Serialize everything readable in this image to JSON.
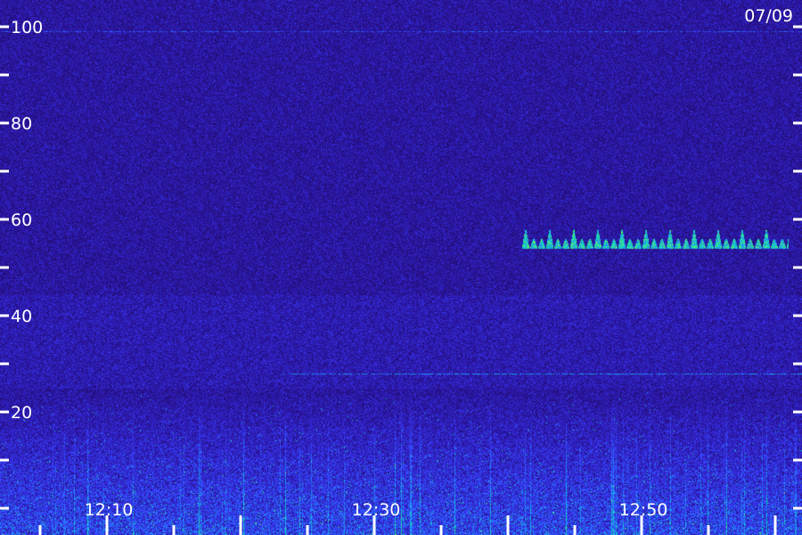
{
  "chart_data": {
    "type": "heatmap",
    "title": "",
    "date_label": "07/09",
    "xlabel": "",
    "ylabel": "",
    "y_axis": {
      "range": [
        0,
        100
      ],
      "labeled_ticks": [
        "20",
        "40",
        "60",
        "80",
        "100"
      ],
      "tick_values": [
        0,
        10,
        20,
        30,
        40,
        50,
        60,
        70,
        80,
        90,
        100
      ],
      "ticks_on_both_sides": true
    },
    "x_axis": {
      "labeled_ticks": [
        "12:10",
        "12:30",
        "12:50"
      ],
      "label_minutes": [
        10,
        30,
        50
      ],
      "major_tick_minutes": [
        0,
        10,
        20,
        30,
        40,
        50,
        60
      ],
      "minor_tick_minutes": [
        5,
        15,
        25,
        35,
        45,
        55
      ],
      "range_minutes": [
        2,
        62
      ]
    },
    "colormap": [
      "#1e0a52",
      "#2a14a0",
      "#3a3cff",
      "#1e8cff",
      "#10d0d0",
      "#30f080",
      "#a0ff30"
    ],
    "features": [
      {
        "label": "",
        "kind": "burst_train",
        "start_minute": 41,
        "end_minute": 61,
        "y_range": [
          54,
          58
        ],
        "intensity": "high"
      },
      {
        "label": "",
        "kind": "horizontal_line",
        "y_value": 99,
        "intensity": "low"
      },
      {
        "label": "",
        "kind": "horizontal_line",
        "y_value": 28,
        "start_minute": 23,
        "end_minute": 62,
        "intensity": "medium"
      },
      {
        "label": "",
        "kind": "broadband_noise",
        "y_range": [
          0,
          25
        ],
        "intensity": "high"
      }
    ]
  }
}
